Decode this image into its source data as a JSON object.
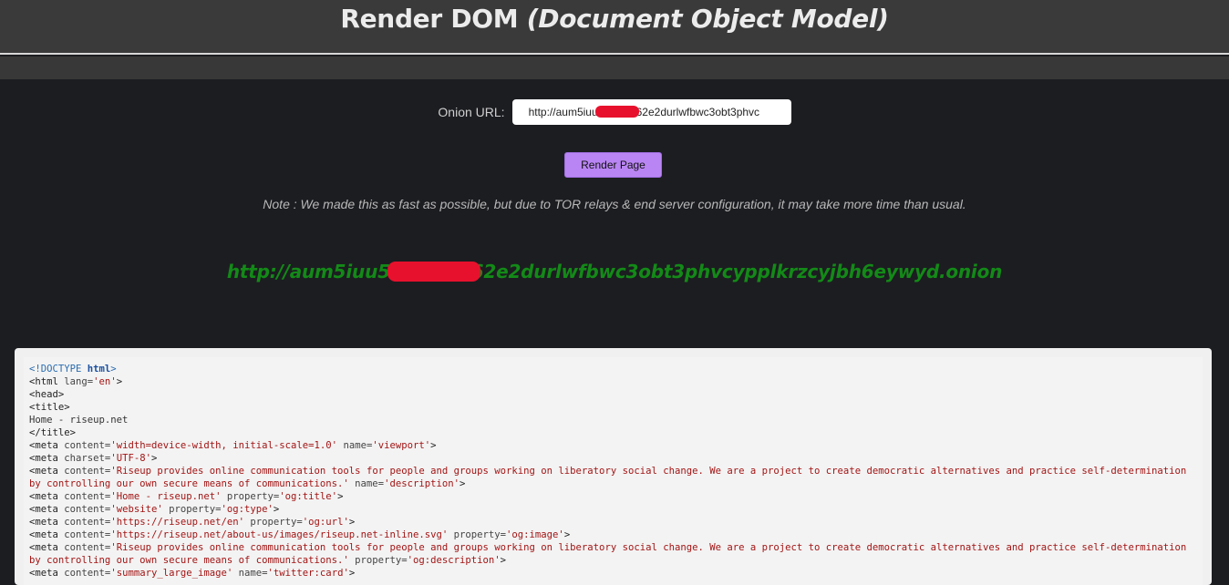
{
  "header": {
    "title_main": "Render DOM ",
    "title_italic": "(Document Object Model)"
  },
  "form": {
    "label": "Onion URL:",
    "input_value": "http://aum5iuu        vfx62e2durlwfbwc3obt3phvc",
    "button_label": "Render Page"
  },
  "note": "Note : We made this as fast as possible, but due to TOR relays & end server configuration, it may take more time than usual.",
  "result_url": "http://aum5iuu5          fx62e2durlwfbwc3obt3phvcypplkrzcyjbh6eywyd.onion",
  "colors": {
    "accent_button": "#b985f4",
    "result_green": "#138a17",
    "redaction_red": "#e8112d"
  },
  "code_lines": [
    [
      {
        "c": "c-dt",
        "t": "<!DOCTYPE "
      },
      {
        "c": "c-dtk",
        "t": "html"
      },
      {
        "c": "c-dt",
        "t": ">"
      }
    ],
    [
      {
        "c": "c-tag",
        "t": "<html "
      },
      {
        "c": "c-attr",
        "t": "lang="
      },
      {
        "c": "c-val",
        "t": "'en'"
      },
      {
        "c": "c-tag",
        "t": ">"
      }
    ],
    [
      {
        "c": "c-tag",
        "t": "<head>"
      }
    ],
    [
      {
        "c": "c-tag",
        "t": "<title>"
      }
    ],
    [
      {
        "c": "c-txt",
        "t": "Home - riseup.net"
      }
    ],
    [
      {
        "c": "c-tag",
        "t": "</title>"
      }
    ],
    [
      {
        "c": "c-tag",
        "t": "<meta "
      },
      {
        "c": "c-attr",
        "t": "content="
      },
      {
        "c": "c-val",
        "t": "'width=device-width, initial-scale=1.0'"
      },
      {
        "c": "c-attr",
        "t": " name="
      },
      {
        "c": "c-val",
        "t": "'viewport'"
      },
      {
        "c": "c-tag",
        "t": ">"
      }
    ],
    [
      {
        "c": "c-tag",
        "t": "<meta "
      },
      {
        "c": "c-attr",
        "t": "charset="
      },
      {
        "c": "c-val",
        "t": "'UTF-8'"
      },
      {
        "c": "c-tag",
        "t": ">"
      }
    ],
    [
      {
        "c": "c-tag",
        "t": "<meta "
      },
      {
        "c": "c-attr",
        "t": "content="
      },
      {
        "c": "c-val",
        "t": "'Riseup provides online communication tools for people and groups working on liberatory social change. We are a project to create democratic alternatives and practice self-determination by controlling our own secure means of communications.'"
      },
      {
        "c": "c-attr",
        "t": " name="
      },
      {
        "c": "c-val",
        "t": "'description'"
      },
      {
        "c": "c-tag",
        "t": ">"
      }
    ],
    [
      {
        "c": "c-tag",
        "t": "<meta "
      },
      {
        "c": "c-attr",
        "t": "content="
      },
      {
        "c": "c-val",
        "t": "'Home - riseup.net'"
      },
      {
        "c": "c-attr",
        "t": " property="
      },
      {
        "c": "c-val",
        "t": "'og:title'"
      },
      {
        "c": "c-tag",
        "t": ">"
      }
    ],
    [
      {
        "c": "c-tag",
        "t": "<meta "
      },
      {
        "c": "c-attr",
        "t": "content="
      },
      {
        "c": "c-val",
        "t": "'website'"
      },
      {
        "c": "c-attr",
        "t": " property="
      },
      {
        "c": "c-val",
        "t": "'og:type'"
      },
      {
        "c": "c-tag",
        "t": ">"
      }
    ],
    [
      {
        "c": "c-tag",
        "t": "<meta "
      },
      {
        "c": "c-attr",
        "t": "content="
      },
      {
        "c": "c-val",
        "t": "'https://riseup.net/en'"
      },
      {
        "c": "c-attr",
        "t": " property="
      },
      {
        "c": "c-val",
        "t": "'og:url'"
      },
      {
        "c": "c-tag",
        "t": ">"
      }
    ],
    [
      {
        "c": "c-tag",
        "t": "<meta "
      },
      {
        "c": "c-attr",
        "t": "content="
      },
      {
        "c": "c-val",
        "t": "'https://riseup.net/about-us/images/riseup.net-inline.svg'"
      },
      {
        "c": "c-attr",
        "t": " property="
      },
      {
        "c": "c-val",
        "t": "'og:image'"
      },
      {
        "c": "c-tag",
        "t": ">"
      }
    ],
    [
      {
        "c": "c-tag",
        "t": "<meta "
      },
      {
        "c": "c-attr",
        "t": "content="
      },
      {
        "c": "c-val",
        "t": "'Riseup provides online communication tools for people and groups working on liberatory social change. We are a project to create democratic alternatives and practice self-determination by controlling our own secure means of communications.'"
      },
      {
        "c": "c-attr",
        "t": " property="
      },
      {
        "c": "c-val",
        "t": "'og:description'"
      },
      {
        "c": "c-tag",
        "t": ">"
      }
    ],
    [
      {
        "c": "c-tag",
        "t": "<meta "
      },
      {
        "c": "c-attr",
        "t": "content="
      },
      {
        "c": "c-val",
        "t": "'summary_large_image'"
      },
      {
        "c": "c-attr",
        "t": " name="
      },
      {
        "c": "c-val",
        "t": "'twitter:card'"
      },
      {
        "c": "c-tag",
        "t": ">"
      }
    ]
  ]
}
